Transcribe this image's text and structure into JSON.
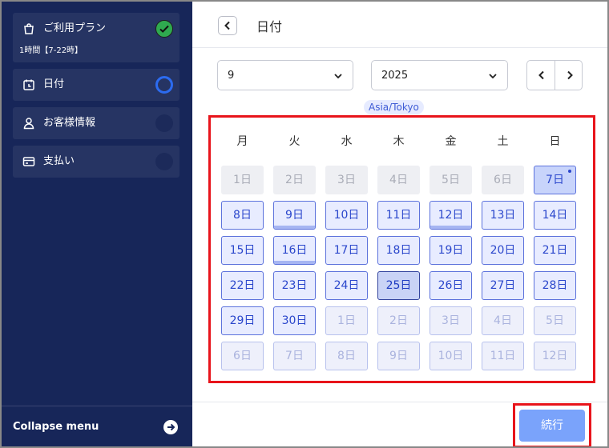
{
  "sidebar": {
    "steps": [
      {
        "label": "ご利用プラン",
        "sub": "1時間【7-22時】",
        "status": "done",
        "icon": "bag-icon"
      },
      {
        "label": "日付",
        "status": "current",
        "icon": "calendar-icon"
      },
      {
        "label": "お客様情報",
        "status": "pending",
        "icon": "user-icon"
      },
      {
        "label": "支払い",
        "status": "pending",
        "icon": "card-icon"
      }
    ],
    "collapse_label": "Collapse menu"
  },
  "header": {
    "title": "日付"
  },
  "selectors": {
    "month": "9",
    "year": "2025"
  },
  "timezone": "Asia/Tokyo",
  "calendar": {
    "weekdays": [
      "月",
      "火",
      "水",
      "木",
      "金",
      "土",
      "日"
    ],
    "days": [
      {
        "label": "1日",
        "state": "disabled"
      },
      {
        "label": "2日",
        "state": "disabled"
      },
      {
        "label": "3日",
        "state": "disabled"
      },
      {
        "label": "4日",
        "state": "disabled"
      },
      {
        "label": "5日",
        "state": "disabled"
      },
      {
        "label": "6日",
        "state": "disabled"
      },
      {
        "label": "7日",
        "state": "today"
      },
      {
        "label": "8日",
        "state": "avail"
      },
      {
        "label": "9日",
        "state": "avail",
        "partial": true
      },
      {
        "label": "10日",
        "state": "avail"
      },
      {
        "label": "11日",
        "state": "avail"
      },
      {
        "label": "12日",
        "state": "avail",
        "partial": true
      },
      {
        "label": "13日",
        "state": "avail"
      },
      {
        "label": "14日",
        "state": "avail"
      },
      {
        "label": "15日",
        "state": "avail"
      },
      {
        "label": "16日",
        "state": "avail",
        "partial": true
      },
      {
        "label": "17日",
        "state": "avail"
      },
      {
        "label": "18日",
        "state": "avail"
      },
      {
        "label": "19日",
        "state": "avail"
      },
      {
        "label": "20日",
        "state": "avail"
      },
      {
        "label": "21日",
        "state": "avail"
      },
      {
        "label": "22日",
        "state": "avail"
      },
      {
        "label": "23日",
        "state": "avail"
      },
      {
        "label": "24日",
        "state": "avail"
      },
      {
        "label": "25日",
        "state": "selected"
      },
      {
        "label": "26日",
        "state": "avail"
      },
      {
        "label": "27日",
        "state": "avail"
      },
      {
        "label": "28日",
        "state": "avail"
      },
      {
        "label": "29日",
        "state": "avail"
      },
      {
        "label": "30日",
        "state": "avail"
      },
      {
        "label": "1日",
        "state": "next-month"
      },
      {
        "label": "2日",
        "state": "next-month"
      },
      {
        "label": "3日",
        "state": "next-month"
      },
      {
        "label": "4日",
        "state": "next-month"
      },
      {
        "label": "5日",
        "state": "next-month"
      },
      {
        "label": "6日",
        "state": "next-month"
      },
      {
        "label": "7日",
        "state": "next-month"
      },
      {
        "label": "8日",
        "state": "next-month"
      },
      {
        "label": "9日",
        "state": "next-month"
      },
      {
        "label": "10日",
        "state": "next-month"
      },
      {
        "label": "11日",
        "state": "next-month"
      },
      {
        "label": "12日",
        "state": "next-month"
      }
    ]
  },
  "footer": {
    "continue_label": "続行"
  }
}
